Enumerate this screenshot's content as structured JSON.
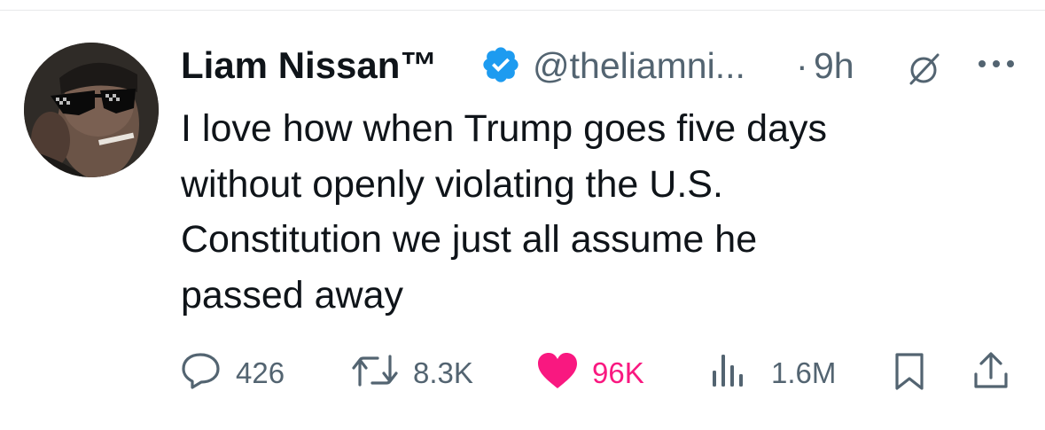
{
  "tweet": {
    "display_name": "Liam Nissan™",
    "handle": "@theliamni...",
    "separator": "·",
    "time": "9h",
    "text_lines": [
      "I love how when Trump goes five days",
      "without openly violating the U.S.",
      "Constitution we just all assume he",
      "passed away"
    ]
  },
  "actions": {
    "replies": "426",
    "reposts": "8.3K",
    "likes": "96K",
    "views": "1.6M"
  },
  "icons": {
    "verified": "verified-badge-icon",
    "null": "empty-set-icon",
    "more": "more-dots-icon",
    "reply": "speech-bubble-icon",
    "repost": "repost-arrows-icon",
    "like": "heart-icon",
    "views": "bar-chart-icon",
    "bookmark": "bookmark-icon",
    "share": "share-upload-icon"
  },
  "colors": {
    "verified_blue": "#1d9bf0",
    "like_pink": "#f91880",
    "secondary_text": "#536471",
    "primary_text": "#0f1419"
  }
}
